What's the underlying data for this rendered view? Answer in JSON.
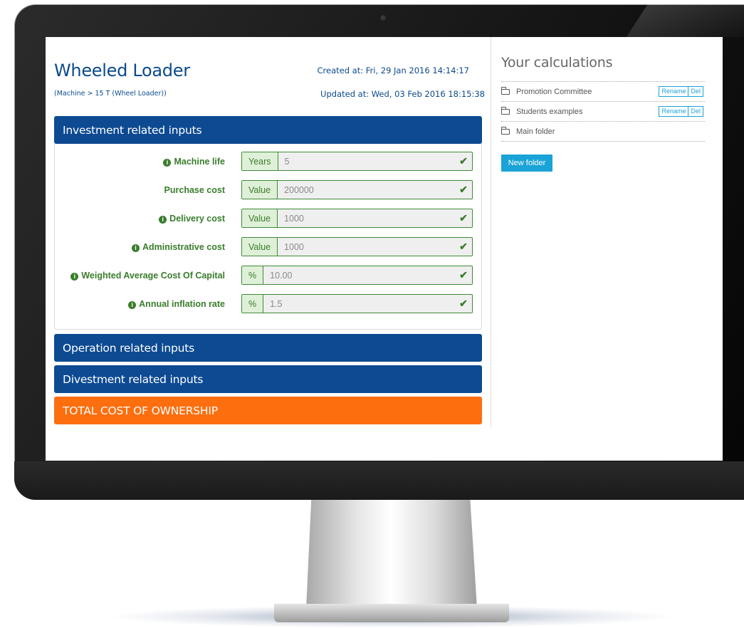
{
  "page": {
    "title": "Wheeled Loader",
    "subtitle": "(Machine > 15 T (Wheel Loader))",
    "created": "Created at: Fri, 29 Jan 2016 14:14:17",
    "updated": "Updated at: Wed, 03 Feb 2016 18:15:38"
  },
  "sections": {
    "investment": "Investment related inputs",
    "operation": "Operation related inputs",
    "divestment": "Divestment related inputs",
    "total": "TOTAL COST OF OWNERSHIP"
  },
  "inputs": [
    {
      "label": "Machine life",
      "info": true,
      "addon": "Years",
      "value": "5"
    },
    {
      "label": "Purchase cost",
      "info": false,
      "addon": "Value",
      "value": "200000"
    },
    {
      "label": "Delivery cost",
      "info": true,
      "addon": "Value",
      "value": "1000"
    },
    {
      "label": "Administrative cost",
      "info": true,
      "addon": "Value",
      "value": "1000"
    },
    {
      "label": "Weighted Average Cost Of Capital",
      "info": true,
      "addon": "%",
      "value": "10.00"
    },
    {
      "label": "Annual inflation rate",
      "info": true,
      "addon": "%",
      "value": "1.5"
    }
  ],
  "sidebar": {
    "title": "Your calculations",
    "folders": [
      {
        "name": "Promotion Committee",
        "rename": "Rename",
        "delete": "Del"
      },
      {
        "name": "Students examples",
        "rename": "Rename",
        "delete": "Del"
      },
      {
        "name": "Main folder"
      }
    ],
    "new_folder": "New folder"
  },
  "icons": {
    "info": "info-circle-icon",
    "check": "checkmark-icon",
    "folder": "folder-icon"
  },
  "colors": {
    "primary_blue": "#0d4a92",
    "total_orange": "#fd6e0f",
    "valid_green": "#3a7d2c",
    "button_cyan": "#1aa3d6"
  }
}
